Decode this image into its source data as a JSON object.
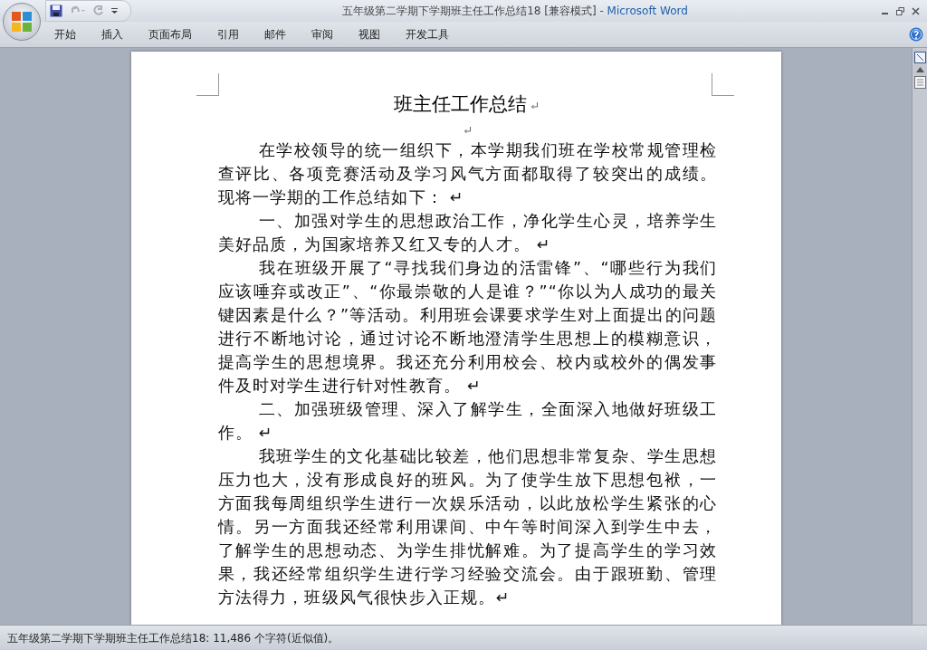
{
  "window": {
    "title": "五年级第二学期下学期班主任工作总结18 [兼容模式]",
    "app_name": "- Microsoft Word"
  },
  "ribbon_tabs": [
    {
      "label": "开始",
      "selected": false
    },
    {
      "label": "插入",
      "selected": false
    },
    {
      "label": "页面布局",
      "selected": false
    },
    {
      "label": "引用",
      "selected": false
    },
    {
      "label": "邮件",
      "selected": false
    },
    {
      "label": "审阅",
      "selected": false
    },
    {
      "label": "视图",
      "selected": false
    },
    {
      "label": "开发工具",
      "selected": false
    }
  ],
  "document": {
    "title": "班主任工作总结",
    "paragraphs": [
      "在学校领导的统一组织下，本学期我们班在学校常规管理检查评比、各项竞赛活动及学习风气方面都取得了较突出的成绩。现将一学期的工作总结如下：  ↵",
      "一、加强对学生的思想政治工作，净化学生心灵，培养学生美好品质，为国家培养又红又专的人才。   ↵",
      "我在班级开展了“寻找我们身边的活雷锋”、“哪些行为我们应该唾弃或改正”、“你最崇敬的人是谁？”“你以为人成功的最关键因素是什么？”等活动。利用班会课要求学生对上面提出的问题进行不断地讨论，通过讨论不断地澄清学生思想上的模糊意识，提高学生的思想境界。我还充分利用校会、校内或校外的偶发事件及时对学生进行针对性教育。 ↵",
      "二、加强班级管理、深入了解学生，全面深入地做好班级工作。  ↵",
      "我班学生的文化基础比较差，他们思想非常复杂、学生思想压力也大，没有形成良好的班风。为了使学生放下思想包袱，一方面我每周组织学生进行一次娱乐活动，以此放松学生紧张的心情。另一方面我还经常利用课间、中午等时间深入到学生中去，了解学生的思想动态、为学生排忧解难。为了提高学生的学习效果，我还经常组织学生进行学习经验交流会。由于跟班勤、管理方法得力，班级风气很快步入正规。↵"
    ]
  },
  "status_bar": {
    "text": "五年级第二学期下学期班主任工作总结18: 11,486 个字符(近似值)。"
  }
}
